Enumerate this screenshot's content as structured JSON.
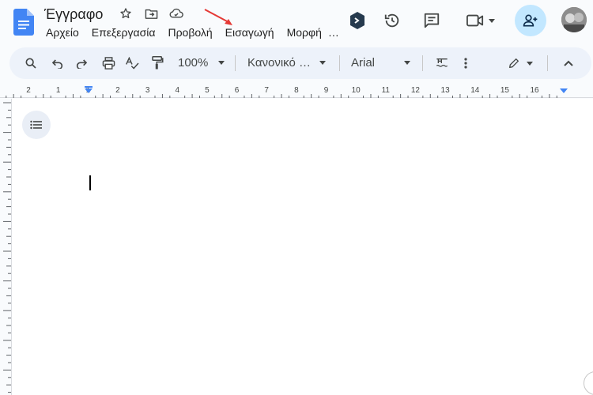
{
  "document": {
    "title": "Έγγραφο"
  },
  "menu": {
    "items": [
      "Αρχείο",
      "Επεξεργασία",
      "Προβολή",
      "Εισαγωγή",
      "Μορφή"
    ],
    "more": "…"
  },
  "toolbar": {
    "zoom": "100%",
    "style": "Κανονικό …",
    "font": "Arial"
  },
  "ruler": {
    "marks": [
      "2",
      "1",
      "1",
      "2",
      "3",
      "4",
      "5",
      "6",
      "7",
      "8",
      "9",
      "10",
      "11",
      "12",
      "13",
      "14",
      "15",
      "16"
    ]
  },
  "colors": {
    "brand_blue": "#4285f4",
    "share_bg": "#c2e7ff",
    "toolbar_bg": "#edf2fa",
    "annotation_arrow": "#e53935"
  },
  "icons": [
    "docs-logo-icon",
    "star-icon",
    "move-folder-icon",
    "cloud-icon",
    "extension-icon",
    "history-icon",
    "comment-icon",
    "meet-icon",
    "share-add-person-icon",
    "search-icon",
    "undo-icon",
    "redo-icon",
    "print-icon",
    "spellcheck-icon",
    "paint-format-icon",
    "line-spacing-icon",
    "more-vert-icon",
    "edit-pencil-icon",
    "chevron-up-icon",
    "outline-list-icon"
  ]
}
